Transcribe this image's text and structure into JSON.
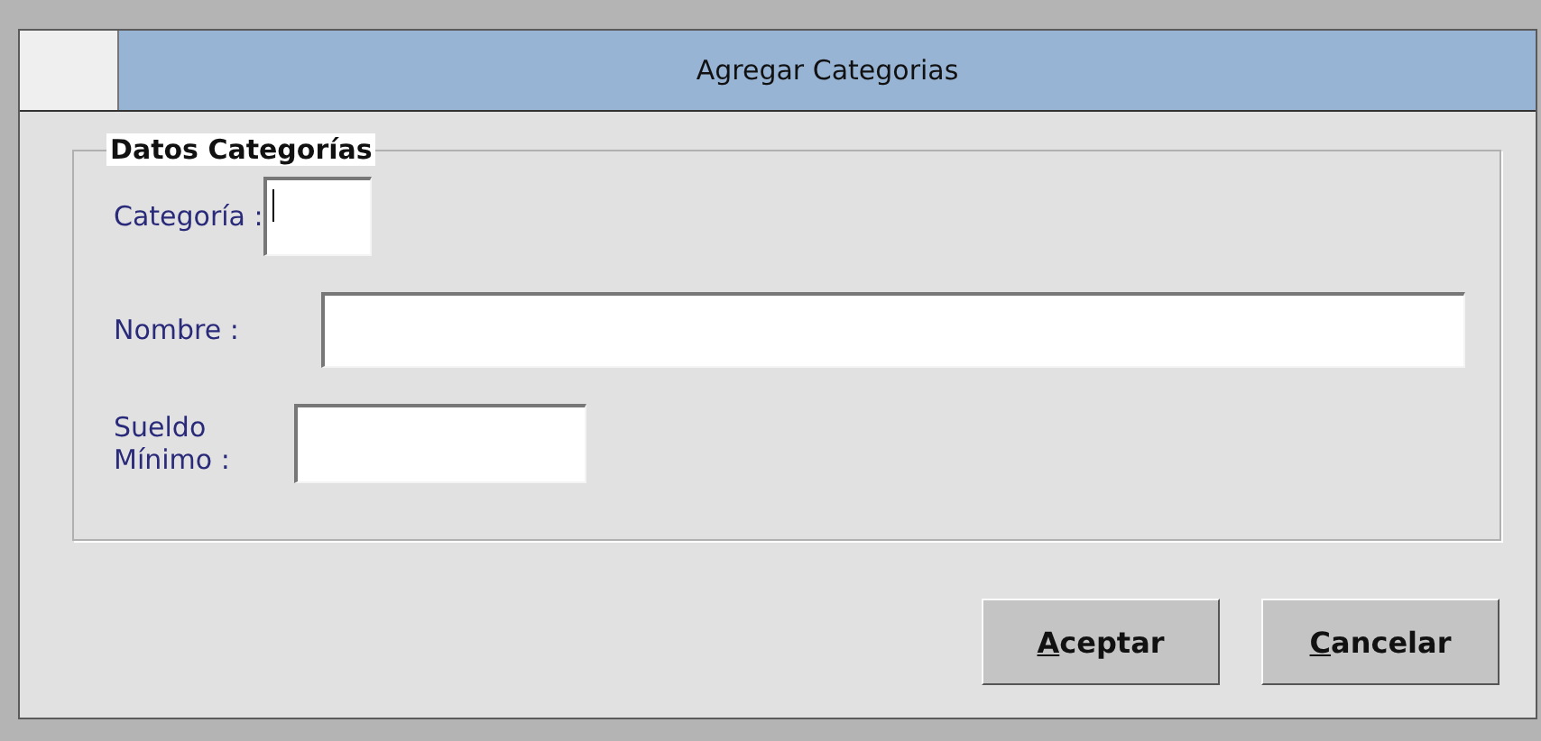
{
  "window": {
    "title": "Agregar Categorias"
  },
  "group": {
    "title": "Datos Categorías",
    "fields": [
      {
        "label": "Categoría :",
        "kind": "code",
        "focused": true
      },
      {
        "label": "Nombre :",
        "kind": "text",
        "focused": false
      },
      {
        "label": "Sueldo Mínimo :",
        "kind": "amount",
        "focused": false
      }
    ]
  },
  "buttons": [
    {
      "label": "Aceptar",
      "access_key_underlined": true
    },
    {
      "label": "Cancelar",
      "access_key_underlined": true
    }
  ]
}
